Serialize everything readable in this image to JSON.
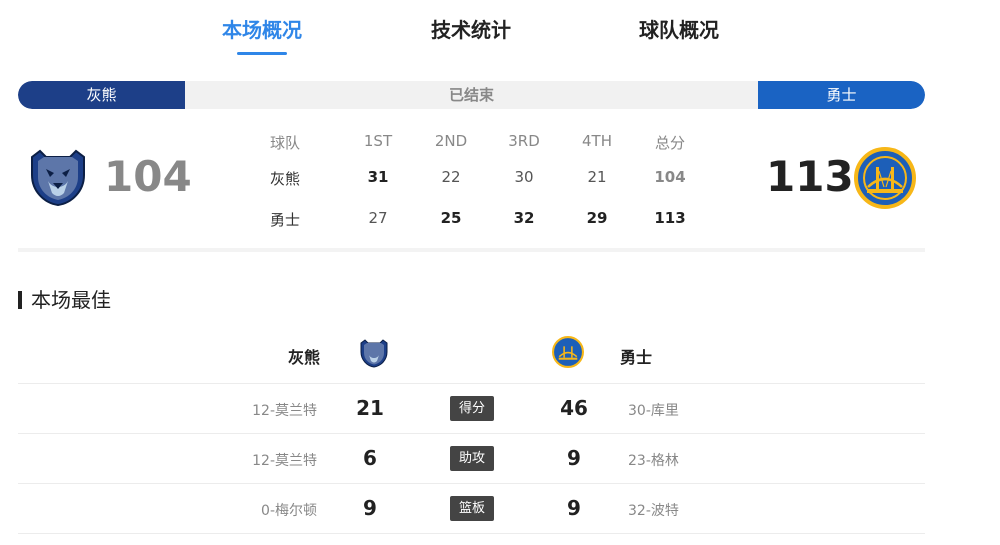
{
  "tabs": [
    {
      "label": "本场概况",
      "active": true
    },
    {
      "label": "技术统计",
      "active": false
    },
    {
      "label": "球队概况",
      "active": false
    }
  ],
  "status_bar": {
    "home_team": "灰熊",
    "status": "已结束",
    "away_team": "勇士",
    "home_color": "#1d3f88",
    "away_color": "#1a63c3"
  },
  "scoreboard": {
    "home_score": "104",
    "away_score": "113",
    "home_logo": "grizzlies-logo-icon",
    "away_logo": "warriors-logo-icon",
    "headers": [
      "球队",
      "1ST",
      "2ND",
      "3RD",
      "4TH",
      "总分"
    ],
    "rows": [
      {
        "team": "灰熊",
        "q1": "31",
        "q2": "22",
        "q3": "30",
        "q4": "21",
        "total": "104"
      },
      {
        "team": "勇士",
        "q1": "27",
        "q2": "25",
        "q3": "32",
        "q4": "29",
        "total": "113"
      }
    ]
  },
  "best": {
    "title": "本场最佳",
    "home_team": "灰熊",
    "away_team": "勇士",
    "rows": [
      {
        "home_player": "12-莫兰特",
        "home_value": "21",
        "stat": "得分",
        "away_value": "46",
        "away_player": "30-库里"
      },
      {
        "home_player": "12-莫兰特",
        "home_value": "6",
        "stat": "助攻",
        "away_value": "9",
        "away_player": "23-格林"
      },
      {
        "home_player": "0-梅尔顿",
        "home_value": "9",
        "stat": "篮板",
        "away_value": "9",
        "away_player": "32-波特"
      }
    ]
  }
}
